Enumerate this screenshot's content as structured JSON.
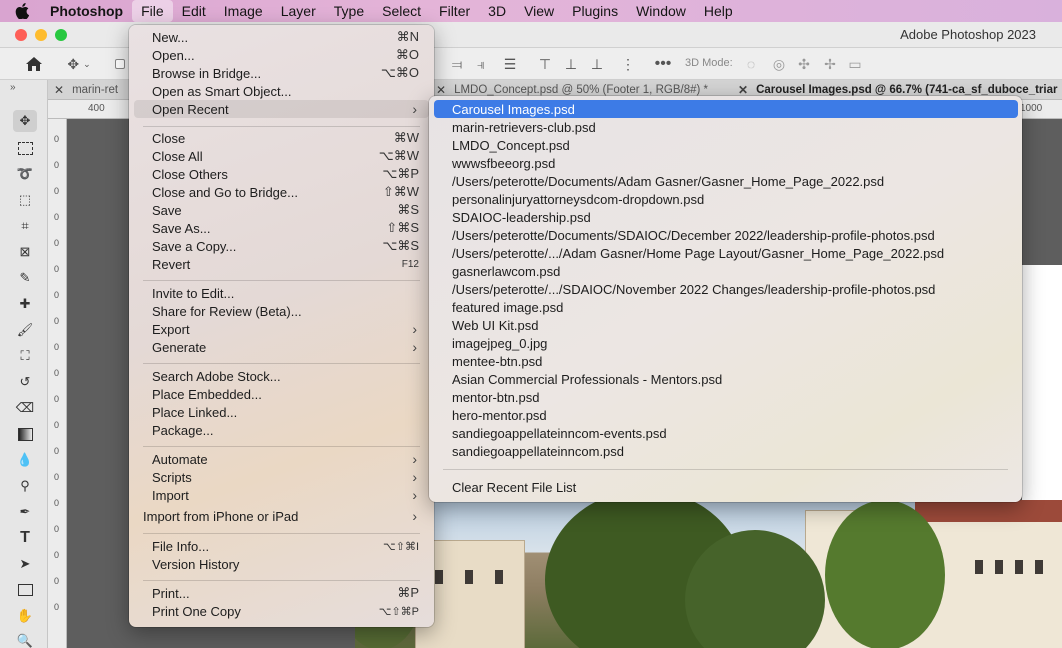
{
  "menubar": {
    "apple_icon": "apple-icon",
    "items": [
      "Photoshop",
      "File",
      "Edit",
      "Image",
      "Layer",
      "Type",
      "Select",
      "Filter",
      "3D",
      "View",
      "Plugins",
      "Window",
      "Help"
    ],
    "active": "File",
    "background": "#e0aed6"
  },
  "window": {
    "title": "Adobe Photoshop 2023"
  },
  "options_bar": {
    "mode_label": "3D Mode:"
  },
  "tabs": [
    {
      "label": "marin-ret"
    },
    {
      "label": "LMDO_Concept.psd @ 50% (Footer 1, RGB/8#) *"
    },
    {
      "label": "Carousel Images.psd @ 66.7% (741-ca_sf_duboce_triar"
    }
  ],
  "ruler": {
    "h_ticks": [
      "400",
      "1000"
    ],
    "v_ticks": [
      "0",
      "0",
      "0",
      "0",
      "0",
      "0",
      "0",
      "0",
      "0",
      "0",
      "0",
      "0",
      "0",
      "0",
      "0",
      "0",
      "0",
      "0",
      "0"
    ]
  },
  "file_menu": {
    "items": [
      {
        "label": "New...",
        "shortcut": "⌘N"
      },
      {
        "label": "Open...",
        "shortcut": "⌘O"
      },
      {
        "label": "Browse in Bridge...",
        "shortcut": "⌥⌘O"
      },
      {
        "label": "Open as Smart Object...",
        "shortcut": ""
      },
      {
        "label": "Open Recent",
        "shortcut": "",
        "submenu": true
      },
      {
        "label": "Close",
        "shortcut": "⌘W"
      },
      {
        "label": "Close All",
        "shortcut": "⌥⌘W"
      },
      {
        "label": "Close Others",
        "shortcut": "⌥⌘P"
      },
      {
        "label": "Close and Go to Bridge...",
        "shortcut": "⇧⌘W"
      },
      {
        "label": "Save",
        "shortcut": "⌘S"
      },
      {
        "label": "Save As...",
        "shortcut": "⇧⌘S"
      },
      {
        "label": "Save a Copy...",
        "shortcut": "⌥⌘S"
      },
      {
        "label": "Revert",
        "shortcut": "F12"
      },
      {
        "label": "Invite to Edit...",
        "shortcut": ""
      },
      {
        "label": "Share for Review (Beta)...",
        "shortcut": ""
      },
      {
        "label": "Export",
        "shortcut": "",
        "submenu": true
      },
      {
        "label": "Generate",
        "shortcut": "",
        "submenu": true
      },
      {
        "label": "Search Adobe Stock...",
        "shortcut": ""
      },
      {
        "label": "Place Embedded...",
        "shortcut": ""
      },
      {
        "label": "Place Linked...",
        "shortcut": ""
      },
      {
        "label": "Package...",
        "shortcut": ""
      },
      {
        "label": "Automate",
        "shortcut": "",
        "submenu": true
      },
      {
        "label": "Scripts",
        "shortcut": "",
        "submenu": true
      },
      {
        "label": "Import",
        "shortcut": "",
        "submenu": true
      },
      {
        "label": "Import from iPhone or iPad",
        "shortcut": "",
        "submenu": true
      },
      {
        "label": "File Info...",
        "shortcut": "⌥⇧⌘I"
      },
      {
        "label": "Version History",
        "shortcut": ""
      },
      {
        "label": "Print...",
        "shortcut": "⌘P"
      },
      {
        "label": "Print One Copy",
        "shortcut": "⌥⇧⌘P"
      }
    ]
  },
  "recent_menu": {
    "selected": "Carousel Images.psd",
    "selected_color": "#3d7be6",
    "items": [
      "Carousel Images.psd",
      "marin-retrievers-club.psd",
      "LMDO_Concept.psd",
      "wwwsfbeeorg.psd",
      "/Users/peterotte/Documents/Adam Gasner/Gasner_Home_Page_2022.psd",
      "personalinjuryattorneysdcom-dropdown.psd",
      "SDAIOC-leadership.psd",
      "/Users/peterotte/Documents/SDAIOC/December 2022/leadership-profile-photos.psd",
      "/Users/peterotte/.../Adam Gasner/Home Page Layout/Gasner_Home_Page_2022.psd",
      "gasnerlawcom.psd",
      "/Users/peterotte/.../SDAIOC/November 2022 Changes/leadership-profile-photos.psd",
      "featured image.psd",
      "Web UI Kit.psd",
      "imagejpeg_0.jpg",
      "mentee-btn.psd",
      "Asian Commercial Professionals - Mentors.psd",
      "mentor-btn.psd",
      "hero-mentor.psd",
      "sandiegoappellateinncom-events.psd",
      "sandiegoappellateinncom.psd"
    ],
    "clear_label": "Clear Recent File List"
  },
  "toolbar": {
    "tools": [
      "move-tool-icon",
      "marquee-tool-icon",
      "lasso-tool-icon",
      "object-select-tool-icon",
      "crop-tool-icon",
      "frame-tool-icon",
      "eyedropper-tool-icon",
      "healing-brush-tool-icon",
      "brush-tool-icon",
      "clone-stamp-tool-icon",
      "history-brush-tool-icon",
      "eraser-tool-icon",
      "gradient-tool-icon",
      "blur-tool-icon",
      "dodge-tool-icon",
      "pen-tool-icon",
      "type-tool-icon",
      "path-select-tool-icon",
      "rectangle-tool-icon",
      "hand-tool-icon",
      "zoom-tool-icon"
    ]
  }
}
